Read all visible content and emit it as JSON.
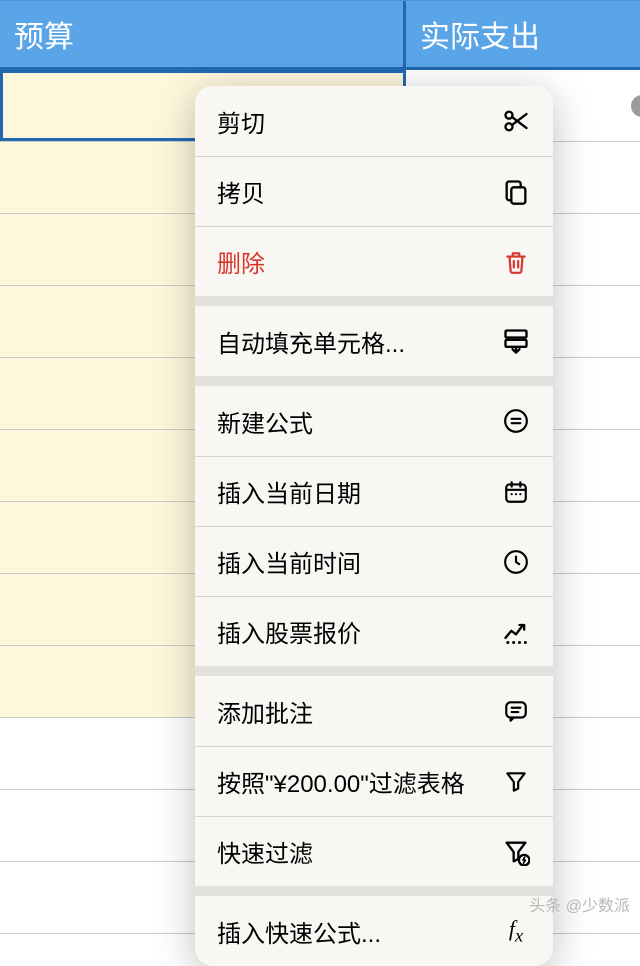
{
  "header": {
    "col1": "预算",
    "col2": "实际支出"
  },
  "menu": {
    "groups": [
      [
        {
          "id": "cut",
          "label": "剪切",
          "icon": "scissors-icon",
          "danger": false
        },
        {
          "id": "copy",
          "label": "拷贝",
          "icon": "copy-icon",
          "danger": false
        },
        {
          "id": "delete",
          "label": "删除",
          "icon": "trash-icon",
          "danger": true
        }
      ],
      [
        {
          "id": "autofill",
          "label": "自动填充单元格...",
          "icon": "autofill-icon",
          "danger": false
        }
      ],
      [
        {
          "id": "newformula",
          "label": "新建公式",
          "icon": "equals-circle-icon",
          "danger": false
        },
        {
          "id": "insertdate",
          "label": "插入当前日期",
          "icon": "calendar-icon",
          "danger": false
        },
        {
          "id": "inserttime",
          "label": "插入当前时间",
          "icon": "clock-icon",
          "danger": false
        },
        {
          "id": "insertstock",
          "label": "插入股票报价",
          "icon": "stock-chart-icon",
          "danger": false
        }
      ],
      [
        {
          "id": "comment",
          "label": "添加批注",
          "icon": "comment-icon",
          "danger": false
        },
        {
          "id": "filterby",
          "label": "按照\"¥200.00\"过滤表格",
          "icon": "funnel-icon",
          "danger": false
        },
        {
          "id": "quickfilter",
          "label": "快速过滤",
          "icon": "funnel-bolt-icon",
          "danger": false
        }
      ],
      [
        {
          "id": "quickformula",
          "label": "插入快速公式...",
          "icon": "fx-icon",
          "danger": false
        }
      ]
    ]
  },
  "watermark": "头条 @少数派"
}
